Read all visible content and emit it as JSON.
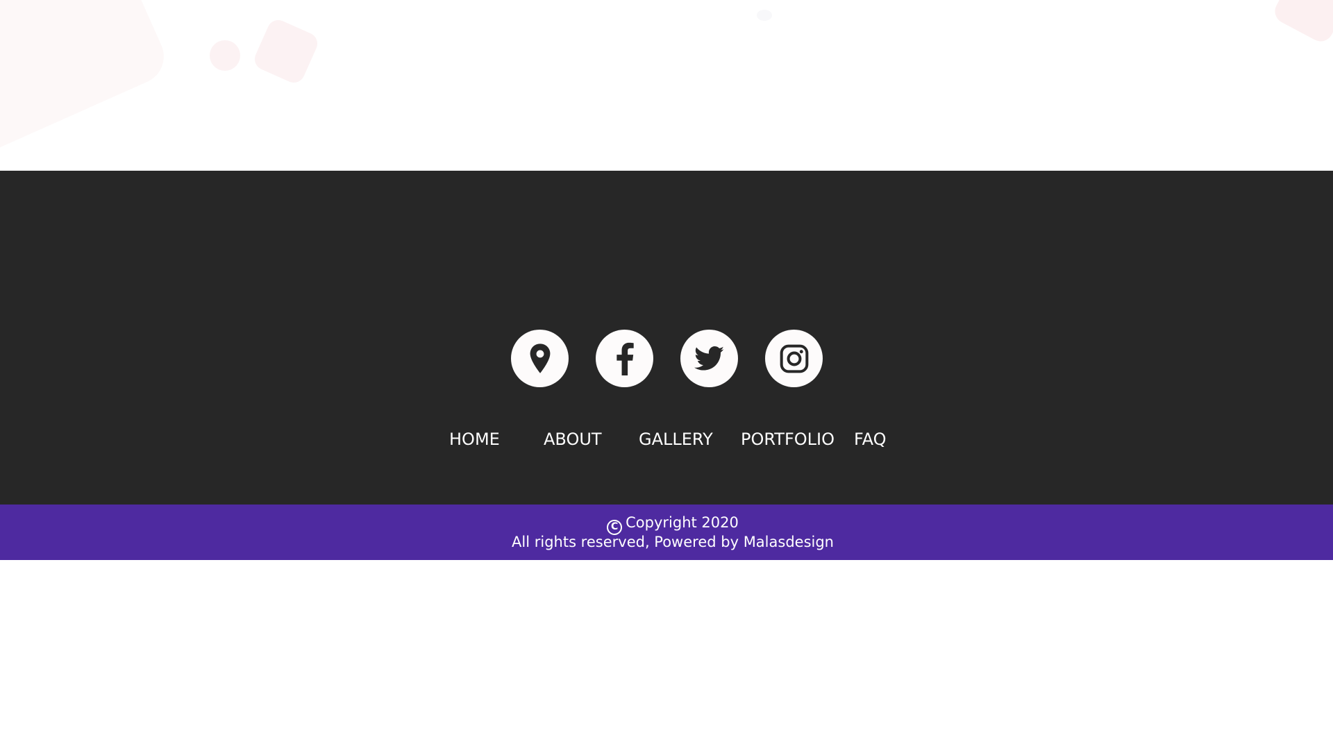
{
  "social": [
    {
      "icon": "location-pin-icon",
      "label": "Location"
    },
    {
      "icon": "facebook-icon",
      "label": "Facebook"
    },
    {
      "icon": "twitter-icon",
      "label": "Twitter"
    },
    {
      "icon": "instagram-icon",
      "label": "Instagram"
    }
  ],
  "nav": {
    "home": "HOME",
    "about": "ABOUT",
    "gallery": "GALLERY",
    "portfolio": "PORTFOLIO",
    "faq": "FAQ"
  },
  "copyright": {
    "symbol": "C",
    "line1": "Copyright 2020",
    "line2": "All rights reserved, Powered by Malasdesign"
  },
  "colors": {
    "footer_bg": "#272727",
    "band_bg": "#4e2aa0",
    "icon_bg": "#fdfbfb",
    "icon_fg": "#272727"
  }
}
